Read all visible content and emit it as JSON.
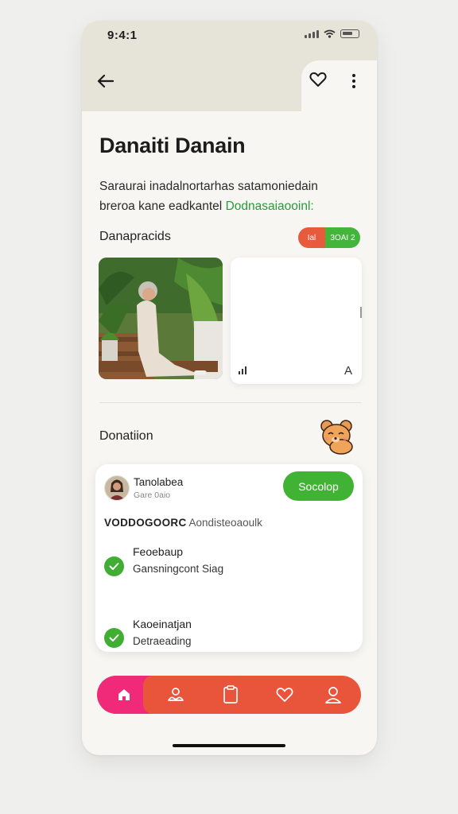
{
  "status": {
    "time": "9:4:1"
  },
  "header": {
    "title": "Danaiti Danain"
  },
  "description": {
    "line1": "Saraurai inadalnortarhas satamoniedain",
    "line2_prefix": "breroa kane eadkantel ",
    "line2_link": "Dodnasaiaooinl:"
  },
  "section1": {
    "label": "Danapracids",
    "pill_left": "Ial",
    "pill_right": "3OAI 2"
  },
  "media_card": {
    "corner_glyph": "A"
  },
  "section2": {
    "label": "Donatiion"
  },
  "donation_card": {
    "user_name": "Tanolabea",
    "user_sub": "Gare 0aio",
    "cta_label": "Socolop",
    "code_bold": "VODDOGOORC",
    "code_rest": " Aondisteoaoulk",
    "items": [
      {
        "title": "Feoebaup",
        "subtitle": "Gansningcont Siag"
      },
      {
        "title": "Kaoeinatjan",
        "subtitle": "Detraeading"
      }
    ]
  },
  "colors": {
    "accent_green": "#41b334",
    "nav_orange": "#e8553b",
    "nav_pink": "#f02a78",
    "header_beige": "#e6e4d8"
  },
  "nav": {
    "items": [
      "home-icon",
      "user-hands-icon",
      "clipboard-icon",
      "heart-icon",
      "profile-icon"
    ]
  }
}
